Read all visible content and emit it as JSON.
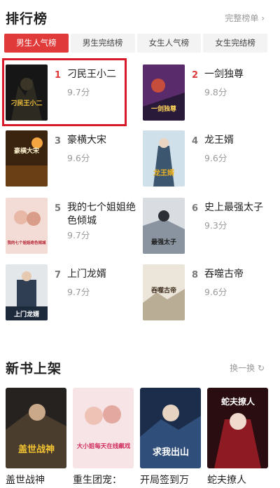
{
  "ranking": {
    "title": "排行榜",
    "more_label": "完整榜单 ›",
    "tabs": [
      {
        "label": "男生人气榜",
        "active": true
      },
      {
        "label": "男生完结榜",
        "active": false
      },
      {
        "label": "女生人气榜",
        "active": false
      },
      {
        "label": "女生完结榜",
        "active": false
      }
    ],
    "books": [
      {
        "rank": "1",
        "name": "刁民王小二",
        "score": "9.7分"
      },
      {
        "rank": "2",
        "name": "一剑独尊",
        "score": "9.8分"
      },
      {
        "rank": "3",
        "name": "豪横大宋",
        "score": "9.6分"
      },
      {
        "rank": "4",
        "name": "龙王婿",
        "score": "9.6分"
      },
      {
        "rank": "5",
        "name": "我的七个姐姐绝色倾城",
        "score": "9.7分"
      },
      {
        "rank": "6",
        "name": "史上最强太子",
        "score": "9.3分"
      },
      {
        "rank": "7",
        "name": "上门龙婿",
        "score": "9.7分"
      },
      {
        "rank": "8",
        "name": "吞噬古帝",
        "score": "9.6分"
      }
    ],
    "cover_titles": [
      "刁民王小二",
      "一剑独尊",
      "豪横大宋",
      "龙王婿",
      "我的七个姐姐绝色倾城",
      "最强太子",
      "上门龙婿",
      "吞噬古帝"
    ]
  },
  "new_books": {
    "title": "新书上架",
    "refresh_label": "换一换 ↻",
    "books": [
      {
        "name": "盖世战神"
      },
      {
        "name": "重生团宠："
      },
      {
        "name": "开局签到万"
      },
      {
        "name": "蛇夫撩人"
      }
    ],
    "cover_titles": [
      "盖世战神",
      "大小姐每天在线飙戏",
      "求我出山",
      "蛇夫撩人"
    ]
  },
  "colors": {
    "accent": "#e03a3a",
    "highlight": "#d8192a"
  }
}
